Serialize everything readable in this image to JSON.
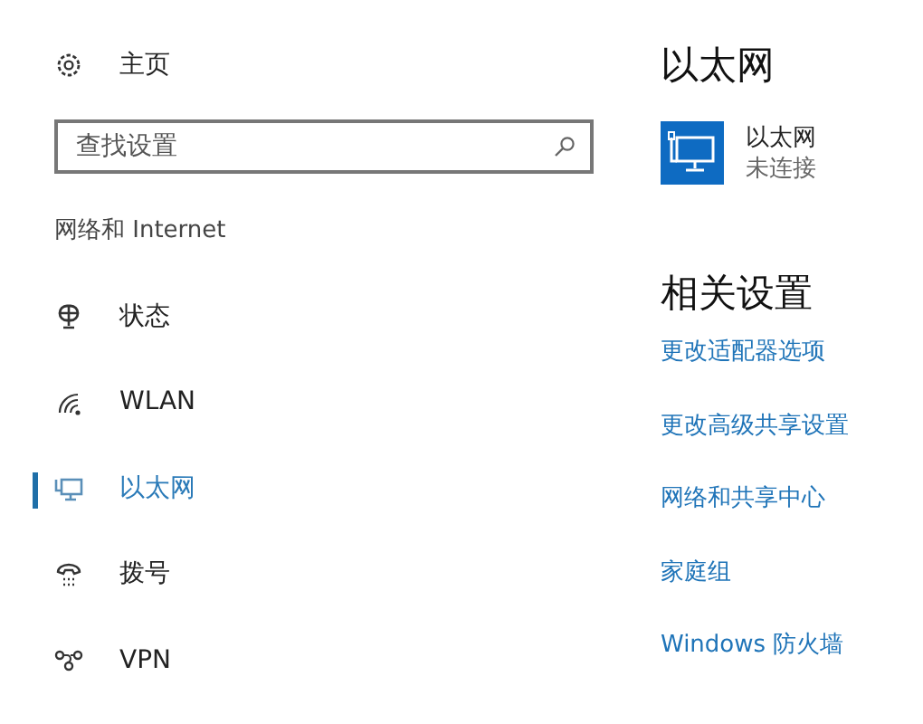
{
  "sidebar": {
    "home": "主页",
    "search": {
      "placeholder": "查找设置"
    },
    "section": "网络和 Internet",
    "items": [
      {
        "label": "状态",
        "selected": false
      },
      {
        "label": "WLAN",
        "selected": false
      },
      {
        "label": "以太网",
        "selected": true
      },
      {
        "label": "拨号",
        "selected": false
      },
      {
        "label": "VPN",
        "selected": false
      }
    ]
  },
  "main": {
    "title": "以太网",
    "adapter": {
      "name": "以太网",
      "status": "未连接"
    },
    "related_title": "相关设置",
    "links": [
      "更改适配器选项",
      "更改高级共享设置",
      "网络和共享中心",
      "家庭组",
      "Windows 防火墙"
    ]
  }
}
